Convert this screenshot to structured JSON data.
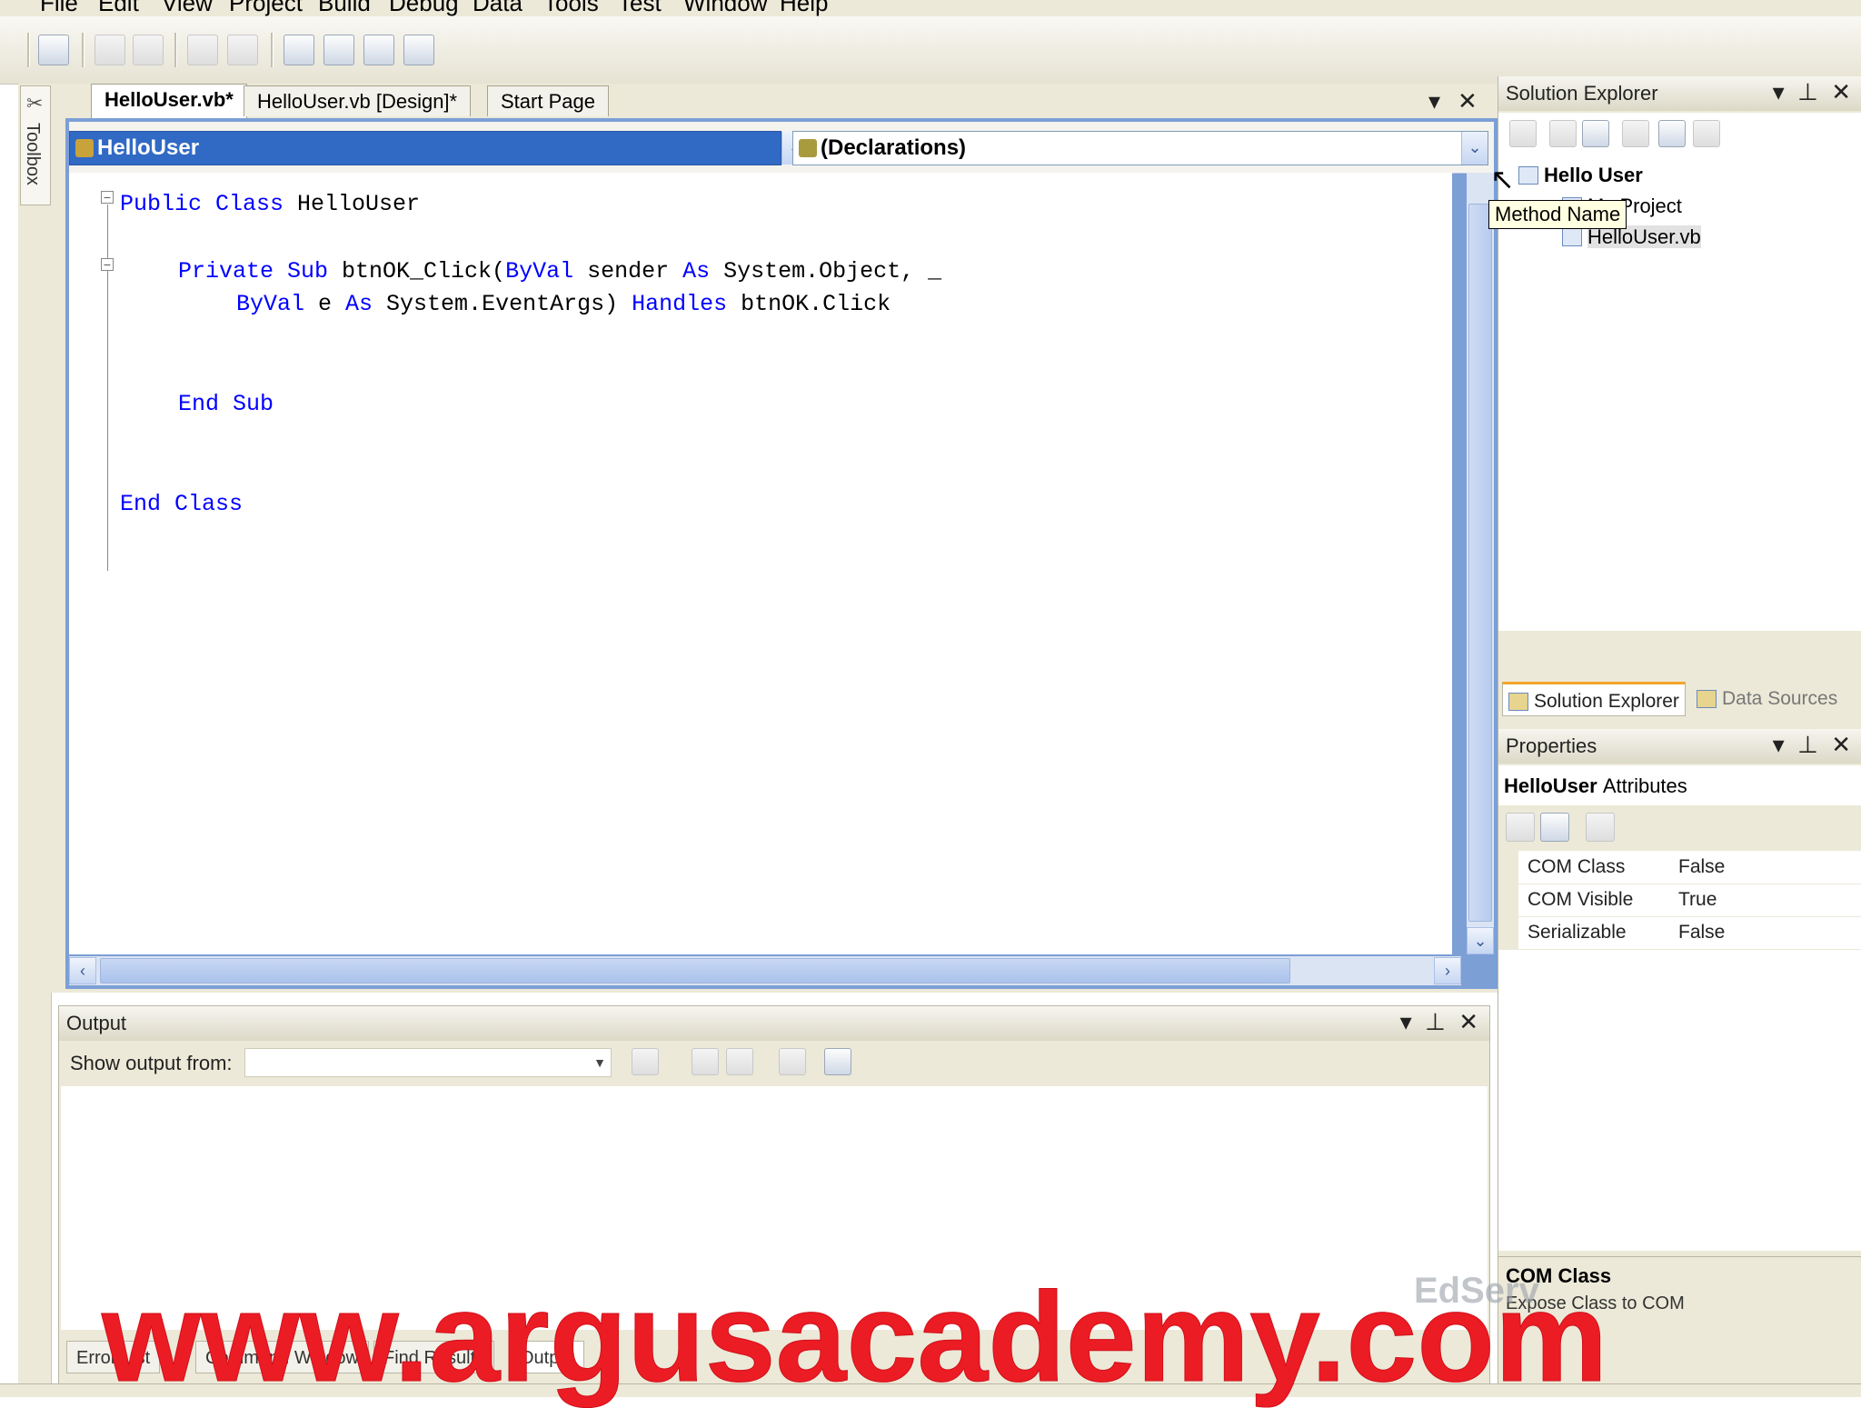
{
  "menubar": {
    "items": [
      "File",
      "Edit",
      "View",
      "Project",
      "Build",
      "Debug",
      "Data",
      "Tools",
      "Test",
      "Window",
      "Help"
    ]
  },
  "toolbar": {
    "icons": [
      "new-project-icon",
      "undo-icon",
      "redo-icon",
      "start-icon",
      "step-icon",
      "form-icon",
      "add-item-icon",
      "table-icon",
      "overflow-icon"
    ]
  },
  "toolbox": {
    "label": "Toolbox"
  },
  "editor": {
    "tabs": [
      "HelloUser.vb*",
      "HelloUser.vb [Design]*",
      "Start Page"
    ],
    "class_combo": "HelloUser",
    "method_combo": "(Declarations)",
    "tooltip": "Method Name",
    "code": {
      "l1_kw": "Public Class",
      "l1_name": " HelloUser",
      "l2_kw1": "Private Sub",
      "l2_text1": " btnOK_Click(",
      "l2_kw2": "ByVal",
      "l2_text2": " sender ",
      "l2_kw3": "As",
      "l2_text3": " System.Object, _",
      "l3_kw1": "ByVal",
      "l3_text1": " e ",
      "l3_kw2": "As",
      "l3_text2": " System.EventArgs) ",
      "l3_kw3": "Handles",
      "l3_text3": " btnOK.Click",
      "l4_kw": "End Sub",
      "l5_kw": "End Class"
    },
    "colors": {
      "keyword": "#0000ff",
      "selection": "#316ac5"
    }
  },
  "output": {
    "title": "Output",
    "show_from_label": "Show output from:",
    "show_from_value": "",
    "tabs": [
      "Error List",
      "Command Window",
      "Find Results",
      "Output"
    ]
  },
  "solution_explorer": {
    "title": "Solution Explorer",
    "tree": [
      "Hello User",
      "My Project",
      "HelloUser.vb"
    ],
    "tabs": [
      "Solution Explorer",
      "Data Sources"
    ]
  },
  "properties": {
    "title": "Properties",
    "object_name": "HelloUser",
    "object_type": "Attributes",
    "rows": [
      {
        "name": "COM Class",
        "value": "False"
      },
      {
        "name": "COM Visible",
        "value": "True"
      },
      {
        "name": "Serializable",
        "value": "False"
      }
    ],
    "desc_title": "COM Class",
    "desc_text": "Expose Class to COM"
  },
  "watermark": {
    "text": "www.argusacademy.com",
    "color": "#ec1c24",
    "logo": "EdServ"
  }
}
